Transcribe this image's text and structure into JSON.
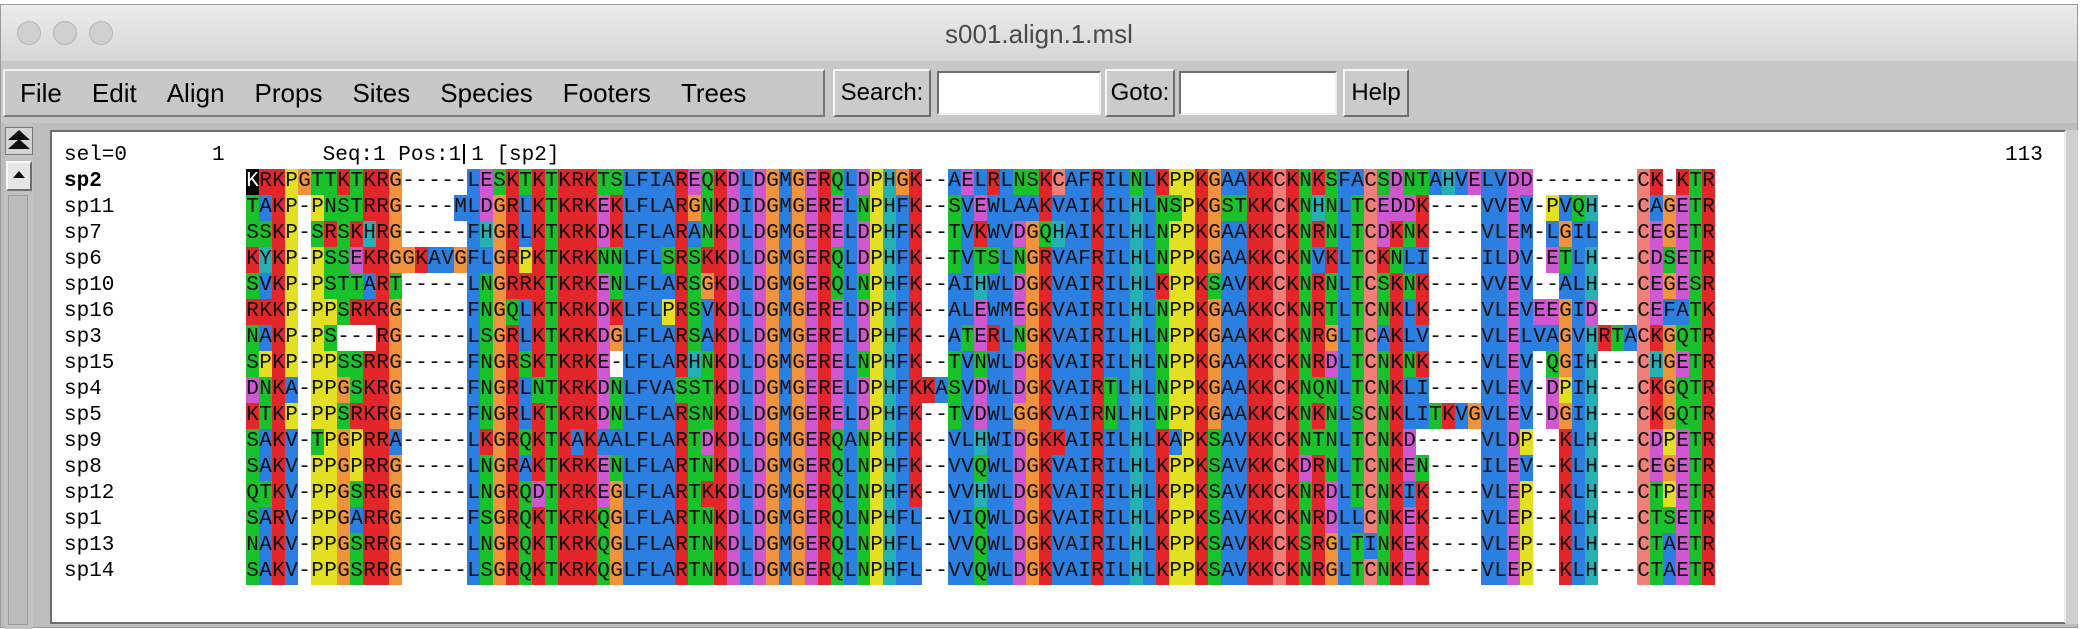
{
  "window": {
    "title": "s001.align.1.msl"
  },
  "menus": [
    "File",
    "Edit",
    "Align",
    "Props",
    "Sites",
    "Species",
    "Footers",
    "Trees"
  ],
  "toolbar": {
    "search_label": "Search:",
    "search_value": "",
    "goto_label": "Goto:",
    "goto_value": "",
    "help_label": "Help"
  },
  "status": {
    "sel": "sel=0",
    "start_pos": "1",
    "info_prefix": "Seq:1 Pos:1",
    "info_suffix": "1 [sp2]",
    "end_pos": "113"
  },
  "selected_sequence": "sp2",
  "sequences": [
    {
      "name": "sp2",
      "seq": "KRKPGTTKTKRG-----LESKTKTKRKTSLFIAREQKDLDGMGERQLDPHGK--AELRLNSKCAFRILNLKPPKGAAKKCKNKSFACSDNTAHVELVDD--------CK-KTR"
    },
    {
      "name": "sp11",
      "seq": "TAKP-PNSTRRG----MLDGRLKTKRKEKLFLARGNKDIDGMGERELNPHFK--SVEWLAAKVAIKILHLNSPKGSTKKCKNHNLTCEDDK----VVEV-PVQH---CAGETR"
    },
    {
      "name": "sp7",
      "seq": "SSKP-SRSKHRG-----FHGRLKTKRKDKLFLARANKDLDGMGERELDPHFK--TVKWVDGQHAIKILHLNPPKGAAKKCKNRNLTCDKNK----VLEM-LGIL---CEGETR"
    },
    {
      "name": "sp6",
      "seq": "KYKP-PSSEKRGGKAVGFLGRPKTKRKNNLFLSRSKKDLDGMGERQLDPHFK--TVTSLNGRVAFRILHLNPPKGAAKKCKNVKLTCKNLI----ILDV-ETLH---CDSETR"
    },
    {
      "name": "sp10",
      "seq": "SVKP-PSTTART-----LNGRRKTKRKENLFLARSGKDLDGMGERQLNPHFK--AIHWLDGKVAIRILHLKPPKSAVKKCKNRNLTCSKNK----VVEV--ALH---CEGESR"
    },
    {
      "name": "sp16",
      "seq": "RKKP-PPSRKRG-----FNGQLKTKRKDKLFLPRSVKDLDGMGERELDPHFK--ALEWMEGKVAIRILHLNPPKGAAKKCKNRTLTCNKLK----VLEVEEGID---CEFATK"
    },
    {
      "name": "sp3",
      "seq": "NAKP-PS---RG-----LSGRLKTKRKDGLFLARSAKDLDGMGERELDPHFK--ATERLNGKVAIRILHLNPPKGAAKKCKNRGLTCAKLV----VLELVAGVHRTACKGQTR"
    },
    {
      "name": "sp15",
      "seq": "SPKP-PPSSRRG-----FNGRSKTKRKE-LFLARHNKDLDGMGERELNPHFK--TVNWLDGKVAIRILHLNPPKGAAKKCKNRDLTCNKNK----VLEV-QGIH---CHGETR"
    },
    {
      "name": "sp4",
      "seq": "DNKA-PPGSKRG-----FNGRLNTKRKDNLFVASSTKDLDGMGERELDPHFKKASVDWLDGKVAIRTLHLNPPKGAAKKCKNQNLTCNKLI----VLEV-DPIH---CKGQTR"
    },
    {
      "name": "sp5",
      "seq": "KTKP-PPSRKRG-----FNGRLKTKRKDNLFLARSNKDLDGMGERELDPHFK--TVDWLGGKVAIRNLHLNPPKGAAKKCKNKNLSCNKLITKVGVLEV-DGIH---CKGQTR"
    },
    {
      "name": "sp9",
      "seq": "SAKV-TPGPRRA-----LKGRQKTKAKAALFLARTDKDLDGMGERQANPHFK--VLHWIDGKKAIRILHLKAPKSAVKKCKNTNLTCNKD-----VLDP--KLH---CDPETR"
    },
    {
      "name": "sp8",
      "seq": "SAKV-PPGPRRG-----LNGRAKTKRKENLFLARTNKDLDGMGERQLNPHFK--VVQWLDGKVAIRILHLKPPKSAVKKCKDRNLTCNKEN----ILEV--KLH---CEGETR"
    },
    {
      "name": "sp12",
      "seq": "QTKV-PPGSRRG-----LNGRQDTKRKEGLFLARTKKDLDGMGERQLNPHFK--VVHWLDGKVAIRILHLKPPKSAVKKCKNRDLTCNKIK----VLEP--KLH---CTPETR"
    },
    {
      "name": "sp1",
      "seq": "SARV-PPGARRG-----FSGRQKTKRKQGLFLARTNKDLDGMGERQLNPHFL--VIQWLDGKVAIRILHLKPPKSAVKKCKNRDLLCNKEK----VLEP--KLH---CTSETR"
    },
    {
      "name": "sp13",
      "seq": "NAKV-PPGSRRG-----LNGRQKTKRKQGLFLARTNKDLDGMGERQLNPHFL--VVQWLDGKVAIRILHLKPPKSAVKKCKSRGLTINKEK----VLEP--KLH---CTAETR"
    },
    {
      "name": "sp14",
      "seq": "SAKV-PPGSRRG-----LSGRQKTKRKQGLFLARTNKDLDGMGERQLNPHFL--VVQWLDGKVAIRILHLKPPKSAVKKCKNRGLTCNKEK----VLEP--KLH---CTAETR"
    }
  ],
  "residue_colors": {
    "K": "#e2262a",
    "R": "#e2262a",
    "D": "#cf58d0",
    "E": "#cf58d0",
    "A": "#2a7fe0",
    "V": "#2a7fe0",
    "L": "#2a7fe0",
    "I": "#2a7fe0",
    "M": "#2a7fe0",
    "F": "#2a7fe0",
    "W": "#2a7fe0",
    "S": "#19c12a",
    "T": "#19c12a",
    "N": "#19c12a",
    "Q": "#19c12a",
    "G": "#f0933c",
    "P": "#e3e024",
    "C": "#f07f7a",
    "H": "#27b0b4",
    "Y": "#27b0b4"
  },
  "first_residue_highlight": "#000000"
}
